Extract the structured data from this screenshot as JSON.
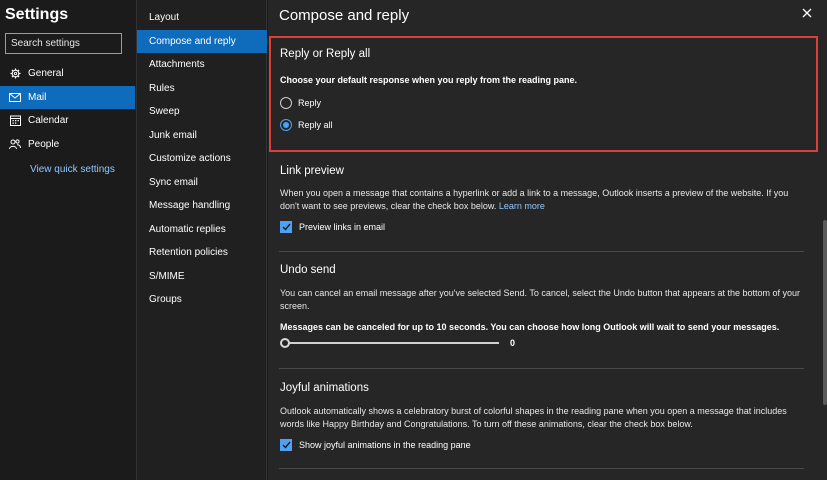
{
  "app": {
    "title": "Settings",
    "search_placeholder": "Search settings",
    "nav": [
      {
        "label": "General",
        "icon": "gear-icon"
      },
      {
        "label": "Mail",
        "icon": "mail-icon",
        "active": true
      },
      {
        "label": "Calendar",
        "icon": "calendar-icon"
      },
      {
        "label": "People",
        "icon": "people-icon"
      }
    ],
    "quick_settings": "View quick settings"
  },
  "submenu": {
    "items": [
      "Layout",
      "Compose and reply",
      "Attachments",
      "Rules",
      "Sweep",
      "Junk email",
      "Customize actions",
      "Sync email",
      "Message handling",
      "Automatic replies",
      "Retention policies",
      "S/MIME",
      "Groups"
    ],
    "active_index": 1
  },
  "main": {
    "title": "Compose and reply",
    "reply": {
      "title": "Reply or Reply all",
      "description": "Choose your default response when you reply from the reading pane.",
      "options": [
        "Reply",
        "Reply all"
      ],
      "selected": "Reply all"
    },
    "link_preview": {
      "title": "Link preview",
      "description": "When you open a message that contains a hyperlink or add a link to a message, Outlook inserts a preview of the website. If you don't want to see previews, clear the check box below.",
      "learn_more": "Learn more",
      "checkbox_label": "Preview links in email",
      "checked": true
    },
    "undo_send": {
      "title": "Undo send",
      "description": "You can cancel an email message after you've selected Send. To cancel, select the Undo button that appears at the bottom of your screen.",
      "note": "Messages can be canceled for up to 10 seconds. You can choose how long Outlook will wait to send your messages.",
      "slider_value": "0"
    },
    "joyful": {
      "title": "Joyful animations",
      "description": "Outlook automatically shows a celebratory burst of colorful shapes in the reading pane when you open a message that includes words like Happy Birthday and Congratulations. To turn off these animations, clear the check box below.",
      "checkbox_label": "Show joyful animations in the reading pane",
      "checked": true
    }
  },
  "colors": {
    "accent": "#0f6cbd",
    "highlight_border": "#d9403a",
    "link": "#8ec8ff"
  }
}
